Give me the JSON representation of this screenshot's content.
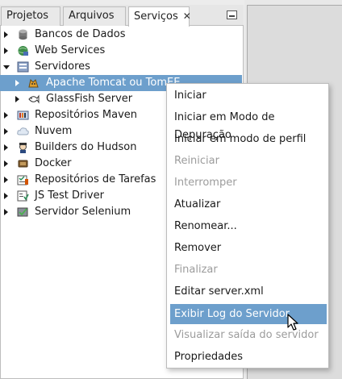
{
  "tabs": {
    "projects": "Projetos",
    "files": "Arquivos",
    "services": "Serviços",
    "services_close": "✕"
  },
  "tree": {
    "databases": "Bancos de Dados",
    "web_services": "Web Services",
    "servers": "Servidores",
    "tomcat": "Apache Tomcat ou TomEE",
    "glassfish": "GlassFish Server",
    "maven": "Repositórios Maven",
    "cloud": "Nuvem",
    "hudson": "Builders do Hudson",
    "docker": "Docker",
    "task_repos": "Repositórios de Tarefas",
    "js_test": "JS Test Driver",
    "selenium": "Servidor Selenium"
  },
  "context_menu": {
    "start": "Iniciar",
    "start_debug": "Iniciar em Modo de Depuração",
    "start_profile": "Iniciar em modo de perfil",
    "restart": "Reiniciar",
    "stop": "Interromper",
    "refresh": "Atualizar",
    "rename": "Renomear...",
    "remove": "Remover",
    "finish": "Finalizar",
    "edit_xml": "Editar server.xml",
    "view_log": "Exibir Log do Servidor",
    "view_output": "Visualizar saída do servidor",
    "properties": "Propriedades"
  },
  "colors": {
    "selection": "#6d9fcc",
    "disabled_text": "#9c9c9c"
  }
}
